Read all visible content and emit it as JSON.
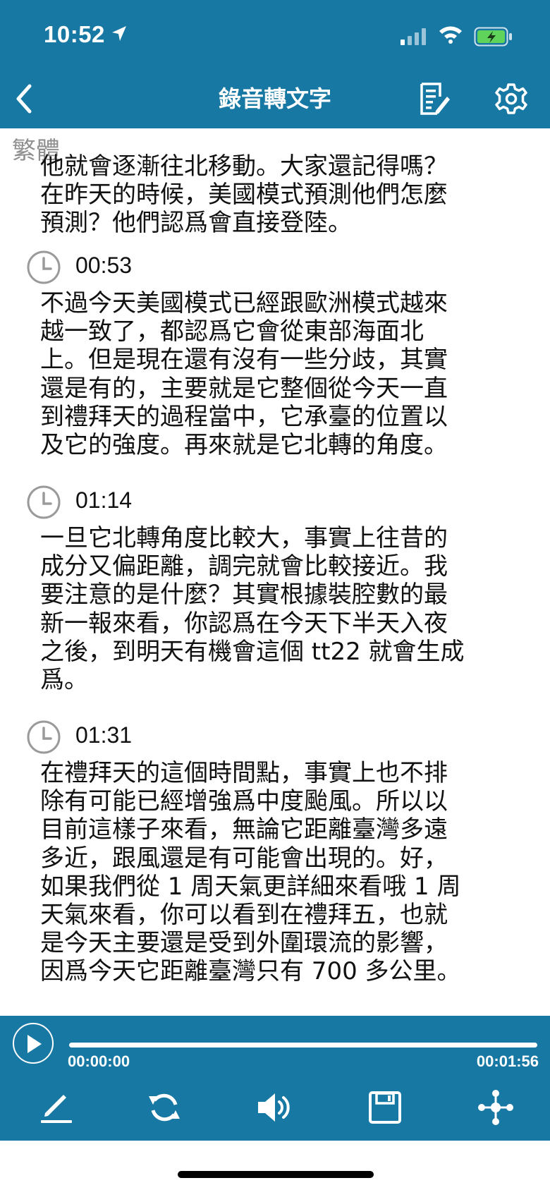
{
  "status_bar": {
    "time": "10:52"
  },
  "nav": {
    "title": "錄音轉文字"
  },
  "transcript": {
    "language_label": "繁體",
    "intro_lines": [
      "他就會逐漸往北移動。大家還記得嗎？",
      "在昨天的時候，美國模式預測他們怎麼",
      "預測？他們認爲會直接登陸。"
    ],
    "segments": [
      {
        "time": "00:53",
        "lines": [
          "不過今天美國模式已經跟歐洲模式越來",
          "越一致了，都認爲它會從東部海面北",
          "上。但是現在還有沒有一些分歧，其實",
          "還是有的，主要就是它整個從今天一直",
          "到禮拜天的過程當中，它承臺的位置以",
          "及它的強度。再來就是它北轉的角度。"
        ]
      },
      {
        "time": "01:14",
        "lines": [
          "一旦它北轉角度比較大，事實上往昔的",
          "成分又偏距離，調完就會比較接近。我",
          "要注意的是什麼？其實根據裝腔數的最",
          "新一報來看，你認爲在今天下半天入夜",
          "之後，到明天有機會這個 tt22 就會生成",
          "爲。"
        ]
      },
      {
        "time": "01:31",
        "lines": [
          "在禮拜天的這個時間點，事實上也不排",
          "除有可能已經增強爲中度颱風。所以以",
          "目前這樣子來看，無論它距離臺灣多遠",
          "多近，跟風還是有可能會出現的。好，",
          "如果我們從 1 周天氣更詳細來看哦 1 周",
          "天氣來看，你可以看到在禮拜五，也就",
          "是今天主要還是受到外圍環流的影響，",
          "因爲今天它距離臺灣只有 700 多公里。"
        ]
      }
    ]
  },
  "player": {
    "current_time": "00:00:00",
    "total_time": "00:01:56",
    "progress": 0,
    "controls": [
      "edit-icon",
      "repeat-icon",
      "volume-icon",
      "save-icon",
      "share-icon"
    ]
  },
  "colors": {
    "bar": "#1878a4",
    "text": "#111111",
    "muted": "#8f8f8f"
  }
}
